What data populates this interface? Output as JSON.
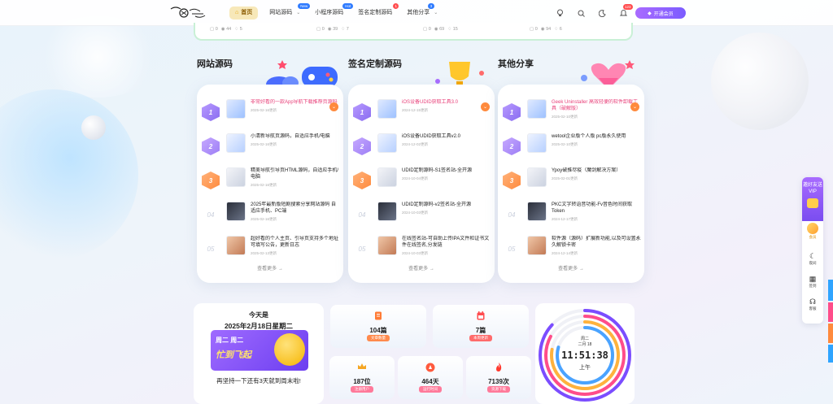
{
  "colors": {
    "accent_purple": "#8a6cf0",
    "accent_orange": "#ff8a3d",
    "highlight_pink": "#e8417a"
  },
  "header": {
    "logo_alt": "logo",
    "nav": [
      {
        "label": "首页",
        "icon": "home-icon",
        "badge": "",
        "dropdown": false
      },
      {
        "label": "网站源码",
        "icon": "",
        "badge": "New",
        "dropdown": true
      },
      {
        "label": "小程序源码",
        "icon": "",
        "badge": "Hot",
        "dropdown": false
      },
      {
        "label": "签名定制源码",
        "icon": "",
        "badge": "1",
        "dropdown": false
      },
      {
        "label": "其他分享",
        "icon": "",
        "badge": "3",
        "dropdown": true
      }
    ],
    "notification_count": "123",
    "vip_button": "开通会员"
  },
  "top_strip": [
    {
      "comments": "0",
      "views": "44",
      "likes": "5"
    },
    {
      "comments": "0",
      "views": "39",
      "likes": "7"
    },
    {
      "comments": "0",
      "views": "69",
      "likes": "15"
    },
    {
      "comments": "0",
      "views": "94",
      "likes": "6"
    }
  ],
  "sections": [
    {
      "title": "网站源码",
      "more": "查看更多 →",
      "items": [
        {
          "rank": "1",
          "title": "非常好看的一款App导航下载推荐页源码",
          "date": "2025-02-16更新",
          "highlight": true
        },
        {
          "rank": "2",
          "title": "小清新导航页源码，自适应手机/电脑",
          "date": "2025-02-16更新",
          "highlight": false
        },
        {
          "rank": "3",
          "title": "精美导航引导页HTML源码，自适应手机/电脑",
          "date": "2025-02-16更新",
          "highlight": false
        },
        {
          "rank": "04",
          "title": "2025年最新版短剧搜索分享网站源码 自适应手机、PC端",
          "date": "2025-02-16更新",
          "highlight": false
        },
        {
          "rank": "05",
          "title": "超好看的个人主页、引导页支持多个地址可填写公告，更新日志",
          "date": "2025-02-13更新",
          "highlight": false
        }
      ]
    },
    {
      "title": "签名定制源码",
      "more": "查看更多 →",
      "items": [
        {
          "rank": "1",
          "title": "iOS设备UDID获取工具3.0",
          "date": "2024-12-15更新",
          "highlight": true
        },
        {
          "rank": "2",
          "title": "iOS设备UDID获取工具v2.0",
          "date": "2024-12-02更新",
          "highlight": false
        },
        {
          "rank": "3",
          "title": "UDID定制源码-S1签名站-全开源",
          "date": "2024-10-04更新",
          "highlight": false
        },
        {
          "rank": "04",
          "title": "UDID定制源码-v2签名站-全开源",
          "date": "2024-10-03更新",
          "highlight": false
        },
        {
          "rank": "05",
          "title": "在线签名站-可自助上传IPA文件和证书文件在线签名,分发链",
          "date": "2024-10-03更新",
          "highlight": false
        }
      ]
    },
    {
      "title": "其他分享",
      "more": "查看更多 →",
      "items": [
        {
          "rank": "1",
          "title": "Geek Uninstaller 高效轻便的软件卸载工具（破解版）",
          "date": "2025-02-10更新",
          "highlight": true
        },
        {
          "rank": "2",
          "title": "wetool企业版个人版 pc版永久使用",
          "date": "2025-02-10更新",
          "highlight": false
        },
        {
          "rank": "3",
          "title": "Ypoy破推尽疫（魔剑解决方案）",
          "date": "2025-02-01更新",
          "highlight": false
        },
        {
          "rank": "04",
          "title": "PKC文字转语音功能-Fv音色时间获取Token",
          "date": "2024-12-17更新",
          "highlight": false
        },
        {
          "rank": "05",
          "title": "软件源（源码）扩展新功能,以及可设置永久解锁卡密",
          "date": "2024-12-14更新",
          "highlight": false
        }
      ]
    }
  ],
  "date_card": {
    "line1": "今天是",
    "line2": "2025年2月18日星期二",
    "banner_top": "周二 周二",
    "banner_main": "忙到飞起",
    "footer": "再坚持一下还有3天就到周末啦!"
  },
  "stats": [
    {
      "value": "104篇",
      "label": "文章数量",
      "icon": "document-icon",
      "color": "#ff7b35"
    },
    {
      "value": "7篇",
      "label": "本周更新",
      "icon": "calendar-icon",
      "color": "#ff4d4f"
    },
    {
      "value": "187位",
      "label": "注册用户",
      "icon": "crown-icon",
      "color": "#f5a623"
    },
    {
      "value": "464天",
      "label": "运行时间",
      "icon": "rocket-icon",
      "color": "#ff5a3d"
    },
    {
      "value": "7139次",
      "label": "资源下载",
      "icon": "fire-icon",
      "color": "#ff3b30"
    }
  ],
  "clock": {
    "weekday": "周二",
    "date": "二月 18",
    "time": "11:51:38",
    "ampm": "上午"
  },
  "side_bar": {
    "invite": "邀好友送VIP",
    "vip": "会员",
    "buttons": [
      "夜间",
      "签到",
      "客服"
    ]
  }
}
